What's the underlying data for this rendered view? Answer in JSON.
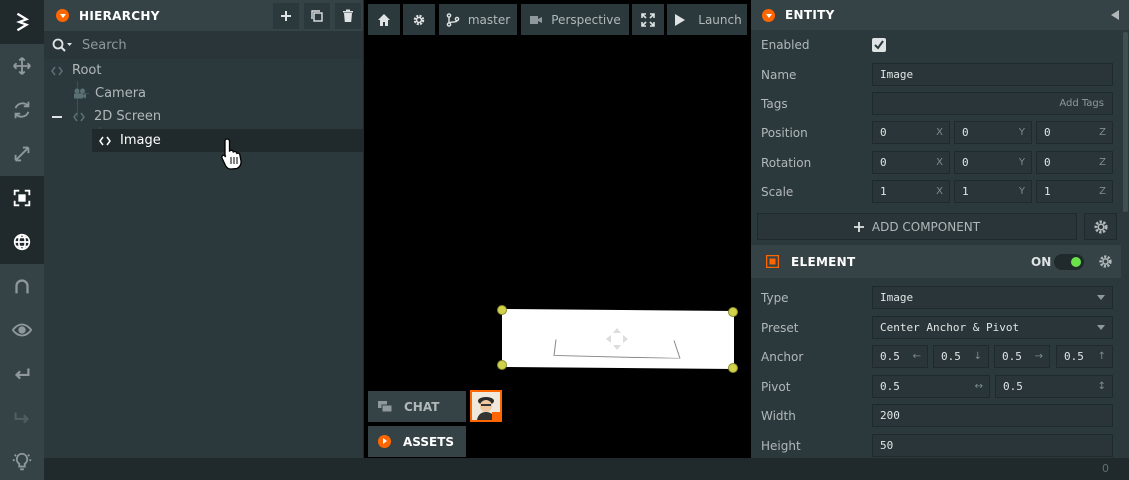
{
  "toolbar": {
    "tools": [
      "logo-icon",
      "move-icon",
      "rotate-icon",
      "scale-icon",
      "resize-icon",
      "world-icon",
      "magnet-icon",
      "eye-icon",
      "undo-icon",
      "redo-icon",
      "lightbulb-icon"
    ]
  },
  "hierarchy": {
    "title": "HIERARCHY",
    "search_placeholder": "Search",
    "items": [
      {
        "label": "Root",
        "icon": "entity-icon"
      },
      {
        "label": "Camera",
        "icon": "camera-icon"
      },
      {
        "label": "2D Screen",
        "icon": "entity-icon"
      },
      {
        "label": "Image",
        "icon": "entity-icon"
      }
    ]
  },
  "viewport": {
    "branch": "master",
    "camera": "Perspective",
    "launch": "Launch",
    "chat": "CHAT",
    "assets": "ASSETS"
  },
  "entity": {
    "title": "ENTITY",
    "enabled_label": "Enabled",
    "name_label": "Name",
    "name_value": "Image",
    "tags_label": "Tags",
    "tags_placeholder": "Add Tags",
    "position_label": "Position",
    "position": [
      "0",
      "0",
      "0"
    ],
    "rotation_label": "Rotation",
    "rotation": [
      "0",
      "0",
      "0"
    ],
    "scale_label": "Scale",
    "scale": [
      "1",
      "1",
      "1"
    ],
    "axes": [
      "X",
      "Y",
      "Z"
    ],
    "add_component": "ADD COMPONENT"
  },
  "element": {
    "title": "ELEMENT",
    "state": "ON",
    "type_label": "Type",
    "type_value": "Image",
    "preset_label": "Preset",
    "preset_value": "Center Anchor & Pivot",
    "anchor_label": "Anchor",
    "anchor": [
      "0.5",
      "0.5",
      "0.5",
      "0.5"
    ],
    "pivot_label": "Pivot",
    "pivot": [
      "0.5",
      "0.5"
    ],
    "width_label": "Width",
    "width_value": "200",
    "height_label": "Height",
    "height_value": "50"
  },
  "status": {
    "count": "0"
  },
  "colors": {
    "accent": "#ff6600",
    "toggle_on": "#6ae34a",
    "panel": "#2c393c",
    "header": "#364346"
  }
}
